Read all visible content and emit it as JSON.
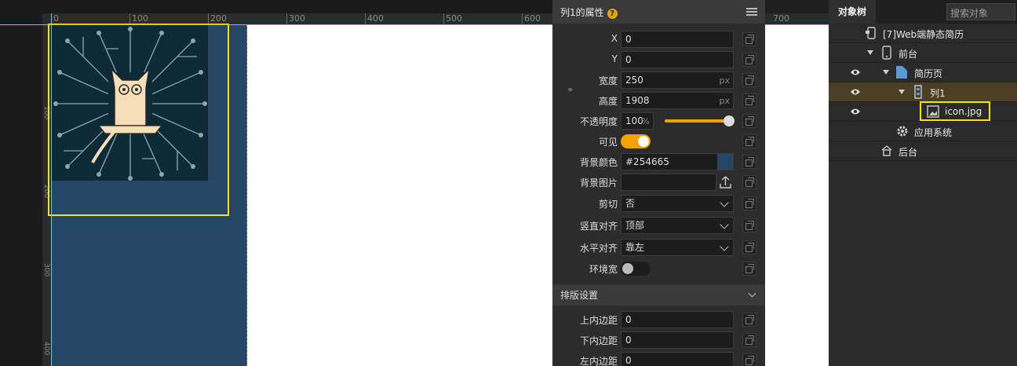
{
  "ruler": {
    "ticks": [
      "0",
      "100",
      "200",
      "300",
      "400",
      "500",
      "600"
    ],
    "vticks": [
      "100",
      "200",
      "300",
      "400"
    ],
    "right_ticks": [
      "700"
    ]
  },
  "canvas": {
    "column_color": "#254665"
  },
  "properties": {
    "title": "列1的属性",
    "help_icon": "?",
    "menu_icon": "hamburger-icon",
    "fields": {
      "x": {
        "label": "X",
        "value": "0"
      },
      "y": {
        "label": "Y",
        "value": "0"
      },
      "width": {
        "label": "宽度",
        "value": "250",
        "unit": "px"
      },
      "height": {
        "label": "高度",
        "value": "1908",
        "unit": "px"
      },
      "opacity": {
        "label": "不透明度",
        "value": "100",
        "unit": "%"
      },
      "visible": {
        "label": "可见",
        "on": true
      },
      "bg_color": {
        "label": "背景颜色",
        "value": "#254665"
      },
      "bg_image": {
        "label": "背景图片",
        "value": ""
      },
      "clip": {
        "label": "剪切",
        "value": "否"
      },
      "valign": {
        "label": "竖直对齐",
        "value": "顶部"
      },
      "halign": {
        "label": "水平对齐",
        "value": "靠左"
      },
      "wrap_width": {
        "label": "环境宽",
        "on": false
      }
    },
    "layout_section": "排版设置",
    "padding": {
      "top": {
        "label": "上内边距",
        "value": "0"
      },
      "bottom": {
        "label": "下内边距",
        "value": "0"
      },
      "left": {
        "label": "左内边距",
        "value": "0"
      }
    }
  },
  "tree": {
    "tab": "对象树",
    "search_placeholder": "搜索对象",
    "items": [
      {
        "label": "[7]Web端静态简历",
        "icon": "phone-app-icon"
      },
      {
        "label": "前台",
        "icon": "mobile-icon"
      },
      {
        "label": "简历页",
        "icon": "page-icon"
      },
      {
        "label": "列1",
        "icon": "column-icon"
      },
      {
        "label": "icon.jpg",
        "icon": "image-icon"
      },
      {
        "label": "应用系统",
        "icon": "gear-icon"
      },
      {
        "label": "后台",
        "icon": "server-icon"
      }
    ]
  }
}
